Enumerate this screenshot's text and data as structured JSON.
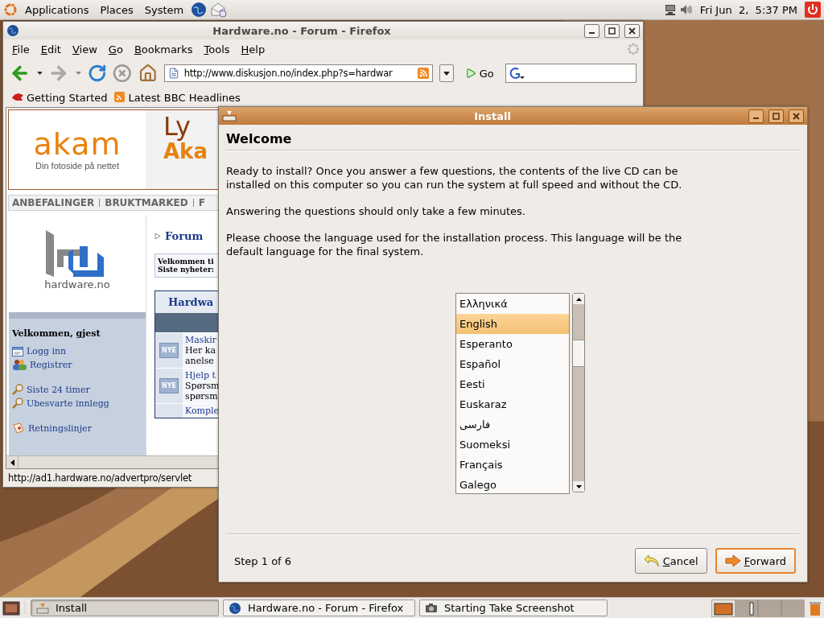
{
  "top_panel": {
    "menus": [
      "Applications",
      "Places",
      "System"
    ],
    "clock": "Fri Jun  2,  5:37 PM"
  },
  "browser": {
    "title": "Hardware.no - Forum - Firefox",
    "menu": [
      "File",
      "Edit",
      "View",
      "Go",
      "Bookmarks",
      "Tools",
      "Help"
    ],
    "url": "http://www.diskusjon.no/index.php?s=hardwar",
    "go": "Go",
    "bookmarks": [
      "Getting Started",
      "Latest BBC Headlines"
    ],
    "page": {
      "banner": {
        "logo": "akam",
        "tagline": "Din fotoside på nettet",
        "headline_1": "Ly",
        "headline_2": "Aka"
      },
      "nav": [
        "ANBEFALINGER",
        "BRUKTMARKED",
        "F"
      ],
      "site_name": "hardware.no",
      "sidebar": {
        "greeting": "Velkommen, gjest",
        "links": [
          {
            "label": "Logg inn",
            "kind": "login"
          },
          {
            "label": "Registrer",
            "kind": "register"
          },
          {
            "label": "Siste 24 timer",
            "kind": "search"
          },
          {
            "label": "Ubesvarte innlegg",
            "kind": "search"
          },
          {
            "label": "Retningslinjer",
            "kind": "rules"
          }
        ]
      },
      "section": "Forum",
      "welcome_box": [
        "Velkommen ti",
        "Siste nyheter:"
      ],
      "forum_table": {
        "title": "Hardwa",
        "rows": [
          {
            "badge": "NYE",
            "lines": [
              "Maskir",
              "Her ka",
              "anelse"
            ]
          },
          {
            "badge": "NYE",
            "lines": [
              "Hjelp t",
              "Spørsm",
              "spørsm"
            ]
          },
          {
            "lines": [
              "Komple"
            ]
          }
        ]
      }
    },
    "status": "http://ad1.hardware.no/advertpro/servlet"
  },
  "dialog": {
    "title": "Install",
    "heading": "Welcome",
    "paragraphs": [
      "Ready to install? Once you answer a few questions, the contents of the live CD can be installed on this computer so you can run the system at full speed and without the CD.",
      "Answering the questions should only take a few minutes.",
      "Please choose the language used for the installation process. This language will be the default language for the final system."
    ],
    "languages": [
      {
        "label": "Ελληνικά",
        "selected": false
      },
      {
        "label": "English",
        "selected": true
      },
      {
        "label": "Esperanto",
        "selected": false
      },
      {
        "label": "Español",
        "selected": false
      },
      {
        "label": "Eesti",
        "selected": false
      },
      {
        "label": "Euskaraz",
        "selected": false
      },
      {
        "label": "فارسی",
        "selected": false
      },
      {
        "label": "Suomeksi",
        "selected": false
      },
      {
        "label": "Français",
        "selected": false
      },
      {
        "label": "Galego",
        "selected": false
      }
    ],
    "step": "Step 1 of 6",
    "buttons": [
      {
        "label": "Cancel",
        "kind": "cancel",
        "default": false
      },
      {
        "label": "Forward",
        "kind": "forward",
        "default": true
      }
    ]
  },
  "taskbar": [
    {
      "label": "Install",
      "kind": "installer",
      "selected": true
    },
    {
      "label": "Hardware.no - Forum - Firefox",
      "kind": "browser",
      "selected": false
    },
    {
      "label": "Starting Take Screenshot",
      "kind": "camera",
      "selected": false
    }
  ]
}
